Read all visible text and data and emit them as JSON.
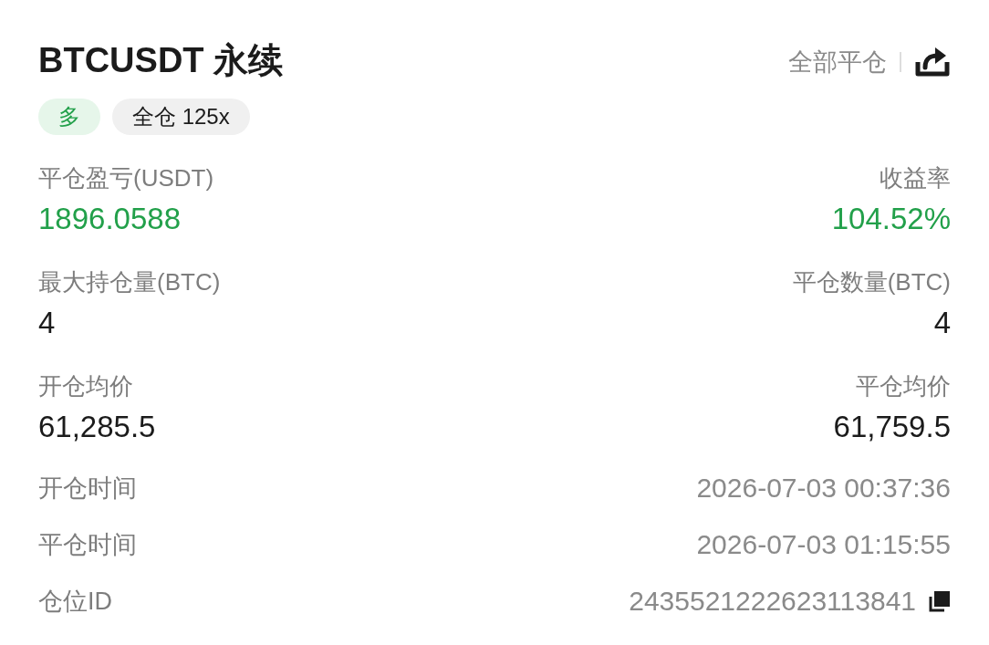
{
  "header": {
    "title": "BTCUSDT 永续",
    "close_all": "全部平仓"
  },
  "tags": [
    {
      "kind": "side",
      "label": "多"
    },
    {
      "kind": "margin",
      "label": "全仓 125x"
    }
  ],
  "stats": [
    {
      "left": {
        "label": "平仓盈亏(USDT)",
        "value": "1896.0588",
        "kind": "profit"
      },
      "right": {
        "label": "收益率",
        "value": "104.52%",
        "kind": "profit"
      }
    },
    {
      "left": {
        "label": "最大持仓量(BTC)",
        "value": "4",
        "kind": "plain"
      },
      "right": {
        "label": "平仓数量(BTC)",
        "value": "4",
        "kind": "plain"
      }
    },
    {
      "left": {
        "label": "开仓均价",
        "value": "61,285.5",
        "kind": "plain"
      },
      "right": {
        "label": "平仓均价",
        "value": "61,759.5",
        "kind": "plain"
      }
    }
  ],
  "details": [
    {
      "label": "开仓时间",
      "value": "2026-07-03 00:37:36",
      "copyable": false
    },
    {
      "label": "平仓时间",
      "value": "2026-07-03 01:15:55",
      "copyable": false
    },
    {
      "label": "仓位ID",
      "value": "2435521222623113841",
      "copyable": true
    }
  ]
}
